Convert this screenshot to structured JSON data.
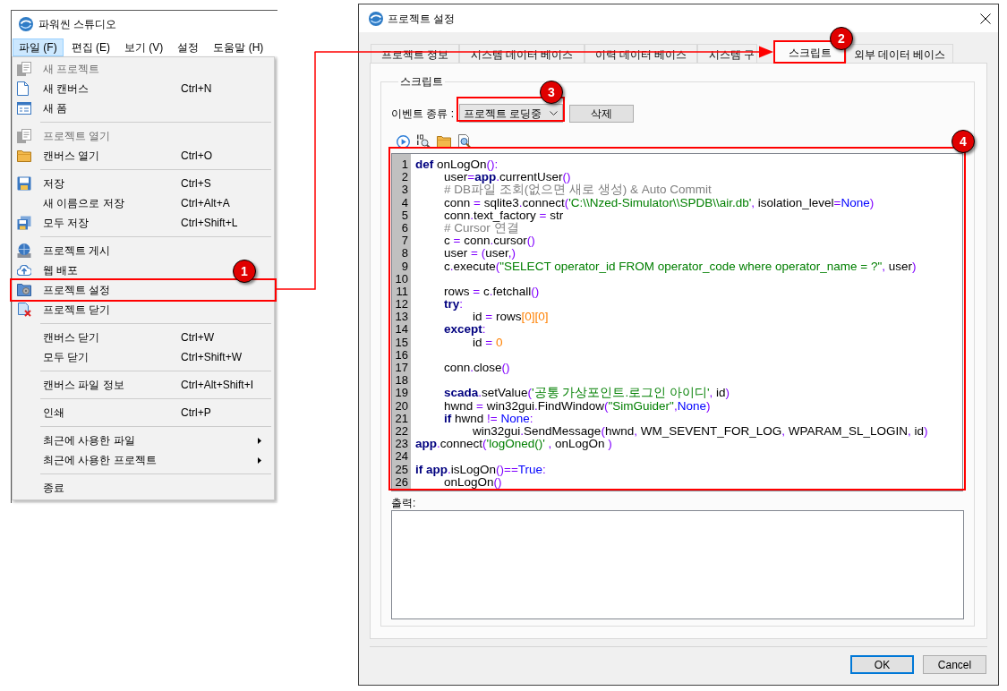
{
  "app_window": {
    "title": "파워씬 스튜디오",
    "menu_bar": [
      {
        "label": "파일 (F)",
        "selected": true
      },
      {
        "label": "편집 (E)",
        "selected": false
      },
      {
        "label": "보기 (V)",
        "selected": false
      },
      {
        "label": "설정",
        "selected": false
      },
      {
        "label": "도움말 (H)",
        "selected": false
      }
    ],
    "file_menu": {
      "groups": [
        [
          {
            "label": "새 프로젝트",
            "disabled": true,
            "submenu": false
          },
          {
            "label": "새 캔버스",
            "shortcut": "Ctrl+N",
            "disabled": false,
            "submenu": false
          },
          {
            "label": "새 폼",
            "disabled": false,
            "submenu": false
          }
        ],
        [
          {
            "label": "프로젝트 열기",
            "disabled": true,
            "submenu": false
          },
          {
            "label": "캔버스 열기",
            "shortcut": "Ctrl+O",
            "disabled": false,
            "submenu": false
          }
        ],
        [
          {
            "label": "저장",
            "shortcut": "Ctrl+S",
            "disabled": false,
            "submenu": false
          },
          {
            "label": "새 이름으로 저장",
            "shortcut": "Ctrl+Alt+A",
            "disabled": false,
            "submenu": false
          },
          {
            "label": "모두 저장",
            "shortcut": "Ctrl+Shift+L",
            "disabled": false,
            "submenu": false
          }
        ],
        [
          {
            "label": "프로젝트 게시",
            "disabled": false,
            "submenu": false
          },
          {
            "label": "웹 배포",
            "disabled": false,
            "submenu": false
          },
          {
            "label": "프로젝트 설정",
            "disabled": false,
            "submenu": false
          },
          {
            "label": "프로젝트 닫기",
            "disabled": false,
            "submenu": false
          }
        ],
        [
          {
            "label": "캔버스 닫기",
            "shortcut": "Ctrl+W",
            "disabled": false,
            "submenu": false
          },
          {
            "label": "모두 닫기",
            "shortcut": "Ctrl+Shift+W",
            "disabled": false,
            "submenu": false
          }
        ],
        [
          {
            "label": "캔버스 파일 정보",
            "shortcut": "Ctrl+Alt+Shift+I",
            "disabled": false,
            "submenu": false
          }
        ],
        [
          {
            "label": "인쇄",
            "shortcut": "Ctrl+P",
            "disabled": false,
            "submenu": false
          }
        ],
        [
          {
            "label": "최근에 사용한 파일",
            "disabled": false,
            "submenu": true
          },
          {
            "label": "최근에 사용한 프로젝트",
            "disabled": false,
            "submenu": true
          }
        ],
        [
          {
            "label": "종료",
            "disabled": false,
            "submenu": false
          }
        ]
      ]
    }
  },
  "dialog": {
    "title": "프로젝트 설정",
    "tabs": [
      {
        "label": "프로젝트 정보",
        "selected": false
      },
      {
        "label": "시스템 데이터 베이스",
        "selected": false
      },
      {
        "label": "이력 데이터 베이스",
        "selected": false
      },
      {
        "label": "시스템 구",
        "selected": false
      },
      {
        "label": "스크립트",
        "selected": true
      },
      {
        "label": "외부 데이터 베이스",
        "selected": false
      }
    ],
    "group_title": "스크립트",
    "event_type": {
      "label": "이벤트 종류 :",
      "value": "프로젝트 로딩중"
    },
    "delete_button": "삭제",
    "code_lines": [
      {
        "number": "1",
        "tokens": [
          {
            "kind": "keyword",
            "text": "def"
          },
          {
            "kind": "plain",
            "text": " onLogOn"
          },
          {
            "kind": "op",
            "text": "():"
          }
        ]
      },
      {
        "number": "2",
        "tokens": [
          {
            "kind": "plain",
            "text": "\tuser"
          },
          {
            "kind": "op",
            "text": "="
          },
          {
            "kind": "keyword",
            "text": "app"
          },
          {
            "kind": "op",
            "text": "."
          },
          {
            "kind": "plain",
            "text": "currentUser"
          },
          {
            "kind": "op",
            "text": "()"
          }
        ]
      },
      {
        "number": "3",
        "tokens": [
          {
            "kind": "comment",
            "text": "\t# DB파일 조회(없으면 새로 생성) & Auto Commit"
          }
        ]
      },
      {
        "number": "4",
        "tokens": [
          {
            "kind": "plain",
            "text": "\tconn "
          },
          {
            "kind": "op",
            "text": "="
          },
          {
            "kind": "plain",
            "text": " sqlite3"
          },
          {
            "kind": "op",
            "text": "."
          },
          {
            "kind": "plain",
            "text": "connect"
          },
          {
            "kind": "op",
            "text": "("
          },
          {
            "kind": "string",
            "text": "'C:\\\\Nzed-Simulator\\\\SPDB\\\\air.db'"
          },
          {
            "kind": "op",
            "text": ","
          },
          {
            "kind": "plain",
            "text": " isolation_level"
          },
          {
            "kind": "op",
            "text": "="
          },
          {
            "kind": "const",
            "text": "None"
          },
          {
            "kind": "op",
            "text": ")"
          }
        ]
      },
      {
        "number": "5",
        "tokens": [
          {
            "kind": "plain",
            "text": "\tconn"
          },
          {
            "kind": "op",
            "text": "."
          },
          {
            "kind": "plain",
            "text": "text_factory "
          },
          {
            "kind": "op",
            "text": "="
          },
          {
            "kind": "plain",
            "text": " str"
          }
        ]
      },
      {
        "number": "6",
        "tokens": [
          {
            "kind": "comment",
            "text": "\t# Cursor 연결"
          }
        ]
      },
      {
        "number": "7",
        "tokens": [
          {
            "kind": "plain",
            "text": "\tc "
          },
          {
            "kind": "op",
            "text": "="
          },
          {
            "kind": "plain",
            "text": " conn"
          },
          {
            "kind": "op",
            "text": "."
          },
          {
            "kind": "plain",
            "text": "cursor"
          },
          {
            "kind": "op",
            "text": "()"
          }
        ]
      },
      {
        "number": "8",
        "tokens": [
          {
            "kind": "plain",
            "text": "\tuser "
          },
          {
            "kind": "op",
            "text": "= ("
          },
          {
            "kind": "plain",
            "text": "user"
          },
          {
            "kind": "op",
            "text": ",)"
          }
        ]
      },
      {
        "number": "9",
        "tokens": [
          {
            "kind": "plain",
            "text": "\tc"
          },
          {
            "kind": "op",
            "text": "."
          },
          {
            "kind": "plain",
            "text": "execute"
          },
          {
            "kind": "op",
            "text": "("
          },
          {
            "kind": "string",
            "text": "\"SELECT operator_id FROM operator_code where operator_name = ?\""
          },
          {
            "kind": "op",
            "text": ","
          },
          {
            "kind": "plain",
            "text": " user"
          },
          {
            "kind": "op",
            "text": ")"
          }
        ]
      },
      {
        "number": "10"
      },
      {
        "number": "11",
        "tokens": [
          {
            "kind": "plain",
            "text": "\trows "
          },
          {
            "kind": "op",
            "text": "="
          },
          {
            "kind": "plain",
            "text": " c"
          },
          {
            "kind": "op",
            "text": "."
          },
          {
            "kind": "plain",
            "text": "fetchall"
          },
          {
            "kind": "op",
            "text": "()"
          }
        ]
      },
      {
        "number": "12",
        "tokens": [
          {
            "kind": "keyword",
            "text": "\ttry"
          },
          {
            "kind": "op",
            "text": ":"
          }
        ]
      },
      {
        "number": "13",
        "tokens": [
          {
            "kind": "plain",
            "text": "\t\tid "
          },
          {
            "kind": "op",
            "text": "="
          },
          {
            "kind": "plain",
            "text": " rows"
          },
          {
            "kind": "number",
            "text": "[0][0]"
          }
        ]
      },
      {
        "number": "14",
        "tokens": [
          {
            "kind": "keyword",
            "text": "\texcept"
          },
          {
            "kind": "op",
            "text": ":"
          }
        ]
      },
      {
        "number": "15",
        "tokens": [
          {
            "kind": "plain",
            "text": "\t\tid "
          },
          {
            "kind": "op",
            "text": "= "
          },
          {
            "kind": "number",
            "text": "0"
          }
        ]
      },
      {
        "number": "16"
      },
      {
        "number": "17",
        "tokens": [
          {
            "kind": "plain",
            "text": "\tconn"
          },
          {
            "kind": "op",
            "text": "."
          },
          {
            "kind": "plain",
            "text": "close"
          },
          {
            "kind": "op",
            "text": "()"
          }
        ]
      },
      {
        "number": "18"
      },
      {
        "number": "19",
        "tokens": [
          {
            "kind": "keyword",
            "text": "\tscada"
          },
          {
            "kind": "op",
            "text": "."
          },
          {
            "kind": "plain",
            "text": "setValue"
          },
          {
            "kind": "op",
            "text": "("
          },
          {
            "kind": "string",
            "text": "'공통 가상포인트.로그인 아이디'"
          },
          {
            "kind": "op",
            "text": ","
          },
          {
            "kind": "plain",
            "text": " id"
          },
          {
            "kind": "op",
            "text": ")"
          }
        ]
      },
      {
        "number": "20",
        "tokens": [
          {
            "kind": "plain",
            "text": "\thwnd "
          },
          {
            "kind": "op",
            "text": "="
          },
          {
            "kind": "plain",
            "text": " win32gui"
          },
          {
            "kind": "op",
            "text": "."
          },
          {
            "kind": "plain",
            "text": "FindWindow"
          },
          {
            "kind": "op",
            "text": "("
          },
          {
            "kind": "string",
            "text": "\"SimGuider\""
          },
          {
            "kind": "op",
            "text": ","
          },
          {
            "kind": "const",
            "text": "None"
          },
          {
            "kind": "op",
            "text": ")"
          }
        ]
      },
      {
        "number": "21",
        "tokens": [
          {
            "kind": "keyword",
            "text": "\tif"
          },
          {
            "kind": "plain",
            "text": " hwnd "
          },
          {
            "kind": "op",
            "text": "!= "
          },
          {
            "kind": "const",
            "text": "None"
          },
          {
            "kind": "op",
            "text": ":"
          }
        ]
      },
      {
        "number": "22",
        "tokens": [
          {
            "kind": "plain",
            "text": "\t\twin32gui"
          },
          {
            "kind": "op",
            "text": "."
          },
          {
            "kind": "plain",
            "text": "SendMessage"
          },
          {
            "kind": "op",
            "text": "("
          },
          {
            "kind": "plain",
            "text": "hwnd"
          },
          {
            "kind": "op",
            "text": ","
          },
          {
            "kind": "plain",
            "text": " WM_SEVENT_FOR_LOG"
          },
          {
            "kind": "op",
            "text": ","
          },
          {
            "kind": "plain",
            "text": " WPARAM_SL_LOGIN"
          },
          {
            "kind": "op",
            "text": ","
          },
          {
            "kind": "plain",
            "text": " id"
          },
          {
            "kind": "op",
            "text": ")"
          }
        ]
      },
      {
        "number": "23",
        "tokens": [
          {
            "kind": "keyword",
            "text": "app"
          },
          {
            "kind": "op",
            "text": "."
          },
          {
            "kind": "plain",
            "text": "connect"
          },
          {
            "kind": "op",
            "text": "("
          },
          {
            "kind": "string",
            "text": "'logOned()'"
          },
          {
            "kind": "op",
            "text": " ,"
          },
          {
            "kind": "plain",
            "text": " onLogOn "
          },
          {
            "kind": "op",
            "text": ")"
          }
        ]
      },
      {
        "number": "24"
      },
      {
        "number": "25",
        "tokens": [
          {
            "kind": "keyword",
            "text": "if app"
          },
          {
            "kind": "op",
            "text": "."
          },
          {
            "kind": "plain",
            "text": "isLogOn"
          },
          {
            "kind": "op",
            "text": "()=="
          },
          {
            "kind": "const",
            "text": "True"
          },
          {
            "kind": "op",
            "text": ":"
          }
        ]
      },
      {
        "number": "26",
        "tokens": [
          {
            "kind": "plain",
            "text": "\tonLogOn"
          },
          {
            "kind": "op",
            "text": "()"
          }
        ]
      }
    ],
    "output_label": "출력:",
    "buttons": [
      {
        "label": "OK",
        "default": true
      },
      {
        "label": "Cancel",
        "default": false
      }
    ]
  },
  "annotations": {
    "badges": [
      "1",
      "2",
      "3",
      "4"
    ]
  }
}
